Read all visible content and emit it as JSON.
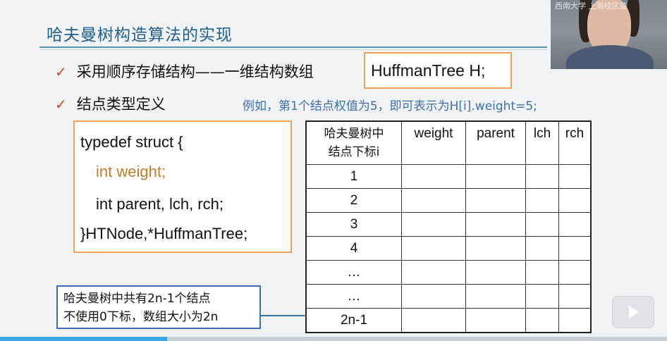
{
  "slide": {
    "title": "哈夫曼树构造算法的实现",
    "bullet1": "采用顺序存储结构——一维结构数组",
    "bullet1_box": "HuffmanTree H;",
    "bullet2": "结点类型定义",
    "example": "例如，第1个结点权值为5，即可表示为H[i].weight=5;",
    "code": {
      "line1": "typedef  struct {",
      "line2": "int weight;",
      "line3": "int parent, lch, rch;",
      "line4": "}HTNode,*HuffmanTree;"
    },
    "table": {
      "index_header_line1": "哈夫曼树中",
      "index_header_line2": "结点下标i",
      "columns": [
        "weight",
        "parent",
        "lch",
        "rch"
      ],
      "rows": [
        "1",
        "2",
        "3",
        "4",
        "…",
        "…",
        "2n-1"
      ]
    },
    "note": {
      "line1": "哈夫曼树中共有2n-1个结点",
      "line2": "不使用0下标，数组大小为2n"
    }
  },
  "webcam": {
    "overlay_text": "西南大学 上海校区监"
  },
  "player": {
    "progress_fraction": 0.25,
    "accent": "#3da7e6"
  },
  "icons": {
    "check": "check-icon",
    "play": "play-icon"
  }
}
